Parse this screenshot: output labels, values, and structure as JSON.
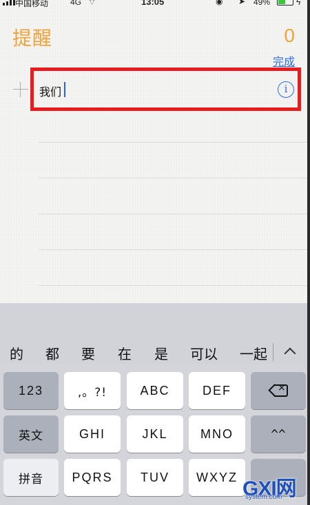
{
  "status_bar": {
    "carrier": "中国移动",
    "network": "4G",
    "time": "13:05",
    "battery": "49%",
    "battery_level": 0.49
  },
  "header": {
    "title": "提醒",
    "count": "0",
    "done_label": "完成"
  },
  "reminder": {
    "text": "我们",
    "highlight_color": "#e81c1c"
  },
  "suggestions": [
    "的",
    "都",
    "要",
    "在",
    "是",
    "可以",
    "一起"
  ],
  "keyboard": {
    "row1": {
      "numbers": "123",
      "punct": ",。?!",
      "k1": "ABC",
      "k2": "DEF"
    },
    "row2": {
      "lang": "英文",
      "k1": "GHI",
      "k2": "JKL",
      "k3": "MNO",
      "emoji": "^^"
    },
    "row3": {
      "pinyin": "拼音",
      "k1": "PQRS",
      "k2": "TUV",
      "k3": "WXYZ"
    }
  },
  "watermark": {
    "brand": "GXI网",
    "site": "system.com"
  },
  "colors": {
    "accent": "#f0a23b",
    "link": "#2d6ce6"
  }
}
